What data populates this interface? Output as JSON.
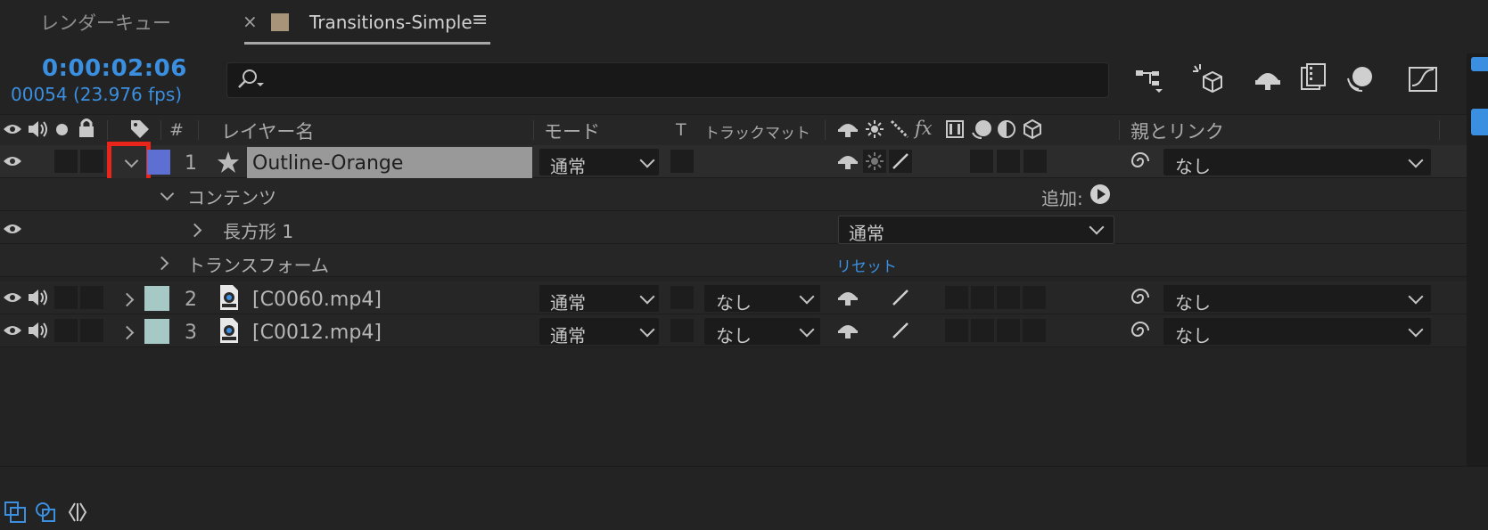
{
  "tabs": {
    "render_queue": "レンダーキュー",
    "close": "×",
    "active": "Transitions-Simple",
    "menu": "≡"
  },
  "time": {
    "timecode": "0:00:02:06",
    "frames": "00054 (23.976 fps)"
  },
  "header": {
    "hash": "#",
    "layer_name": "レイヤー名",
    "mode": "モード",
    "t": "T",
    "track_matte": "トラックマット",
    "fx": "fx",
    "parent_link": "親とリンク"
  },
  "layer1": {
    "number": "1",
    "name": "Outline-Orange",
    "mode": "通常",
    "parent": "なし",
    "color": "#5e6fd4"
  },
  "contents": {
    "label": "コンテンツ",
    "add": "追加:",
    "rect": "長方形 1",
    "rect_mode": "通常",
    "transform": "トランスフォーム",
    "reset": "リセット"
  },
  "layers": [
    {
      "number": "2",
      "name": "[C0060.mp4]",
      "mode": "通常",
      "matte": "なし",
      "parent": "なし",
      "color": "#a6c9c6"
    },
    {
      "number": "3",
      "name": "[C0012.mp4]",
      "mode": "通常",
      "matte": "なし",
      "parent": "なし",
      "color": "#a6c9c6"
    }
  ],
  "colors": {
    "accent": "#3b8fe0",
    "highlight": "#e8241b",
    "panel": "#232323"
  }
}
